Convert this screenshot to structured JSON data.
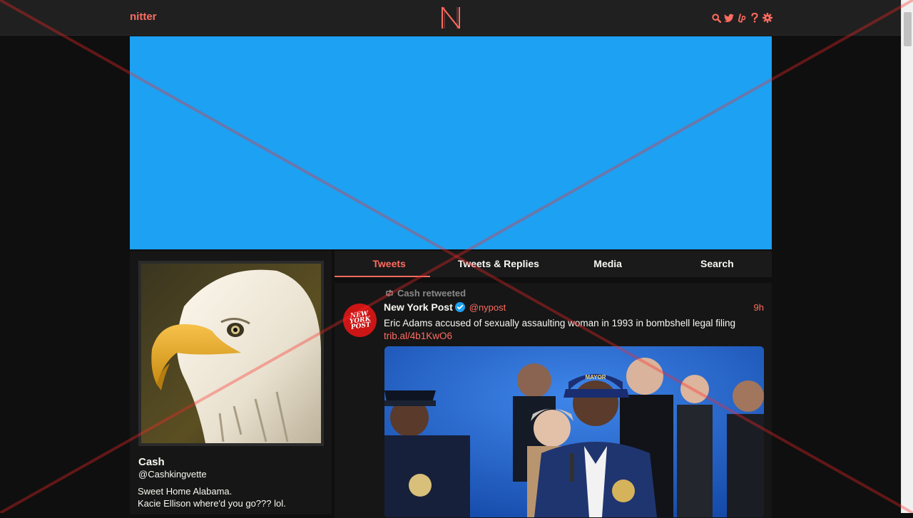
{
  "navbar": {
    "brand": "nitter",
    "logo_letter": "N",
    "icons": [
      "search-icon",
      "twitter-bird-icon",
      "liberapay-icon",
      "help-icon",
      "settings-gear-icon"
    ]
  },
  "colors": {
    "accent": "#ff6c60",
    "banner": "#1da1f2",
    "background": "#0f0f0f",
    "panel": "#161616"
  },
  "profile": {
    "name": "Cash",
    "handle": "@Cashkingvette",
    "bio_lines": [
      "Sweet Home Alabama.",
      "Kacie Ellison where'd you go??? lol."
    ]
  },
  "tabs": [
    {
      "label": "Tweets",
      "active": true
    },
    {
      "label": "Tweets & Replies",
      "active": false
    },
    {
      "label": "Media",
      "active": false
    },
    {
      "label": "Search",
      "active": false
    }
  ],
  "tweet": {
    "retweet_label": "Cash retweeted",
    "fullname": "New York Post",
    "username": "@nypost",
    "date": "9h",
    "text": "Eric Adams accused of sexually assaulting woman in 1993 in bombshell legal filing",
    "link": "trib.al/4b1KwO6",
    "avatar_text": [
      "NEW",
      "YORK",
      "POST"
    ]
  }
}
